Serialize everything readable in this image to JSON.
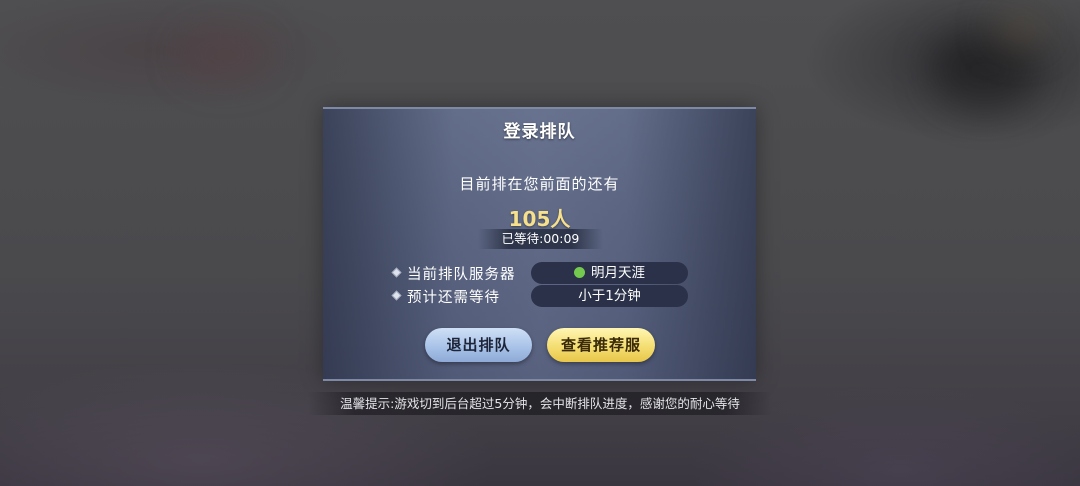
{
  "dialog": {
    "title": "登录排队",
    "ahead_text": "目前排在您前面的还有",
    "queue_count": "105人",
    "waited_time": "已等待:00:09",
    "rows": [
      {
        "label": "当前排队服务器",
        "value": "明月天涯",
        "status_color": "#74c94f"
      },
      {
        "label": "预计还需等待",
        "value": "小于1分钟"
      }
    ],
    "buttons": {
      "exit_label": "退出排队",
      "recommend_label": "查看推荐服"
    }
  },
  "tip": "温馨提示:游戏切到后台超过5分钟，会中断排队进度，感谢您的耐心等待",
  "colors": {
    "count_text": "#f7e08c",
    "exit_button": "#a9c3e8",
    "recommend_button": "#f4de72"
  }
}
